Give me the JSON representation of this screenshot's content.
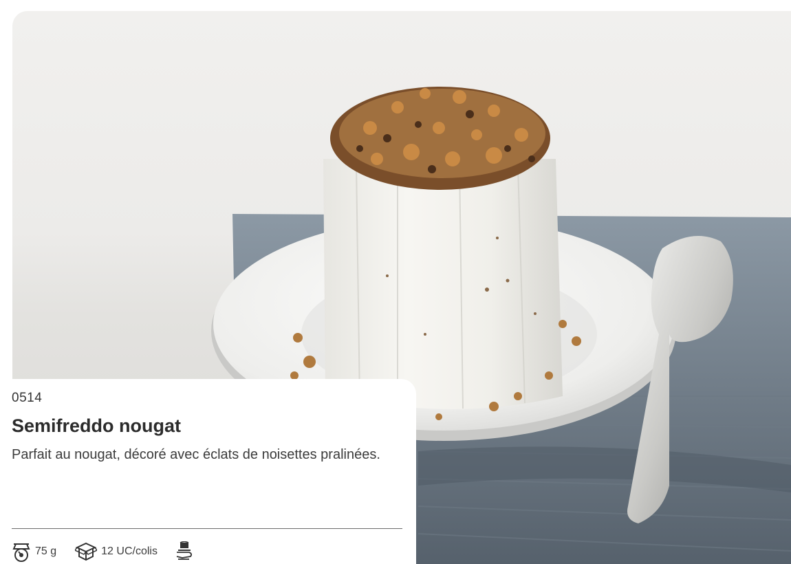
{
  "product": {
    "code": "0514",
    "name": "Semifreddo nougat",
    "description": "Parfait au nougat, décoré avec éclats de noisettes pralinées."
  },
  "specs": [
    {
      "icon": "weight-scale-icon",
      "label": "75 g"
    },
    {
      "icon": "package-box-icon",
      "label": "12 UC/colis"
    },
    {
      "icon": "cake-on-hand-icon",
      "label": ""
    }
  ],
  "colors": {
    "card_background": "#ffffff",
    "text_dark": "#2b2b2b",
    "divider": "#6a6a6a"
  }
}
